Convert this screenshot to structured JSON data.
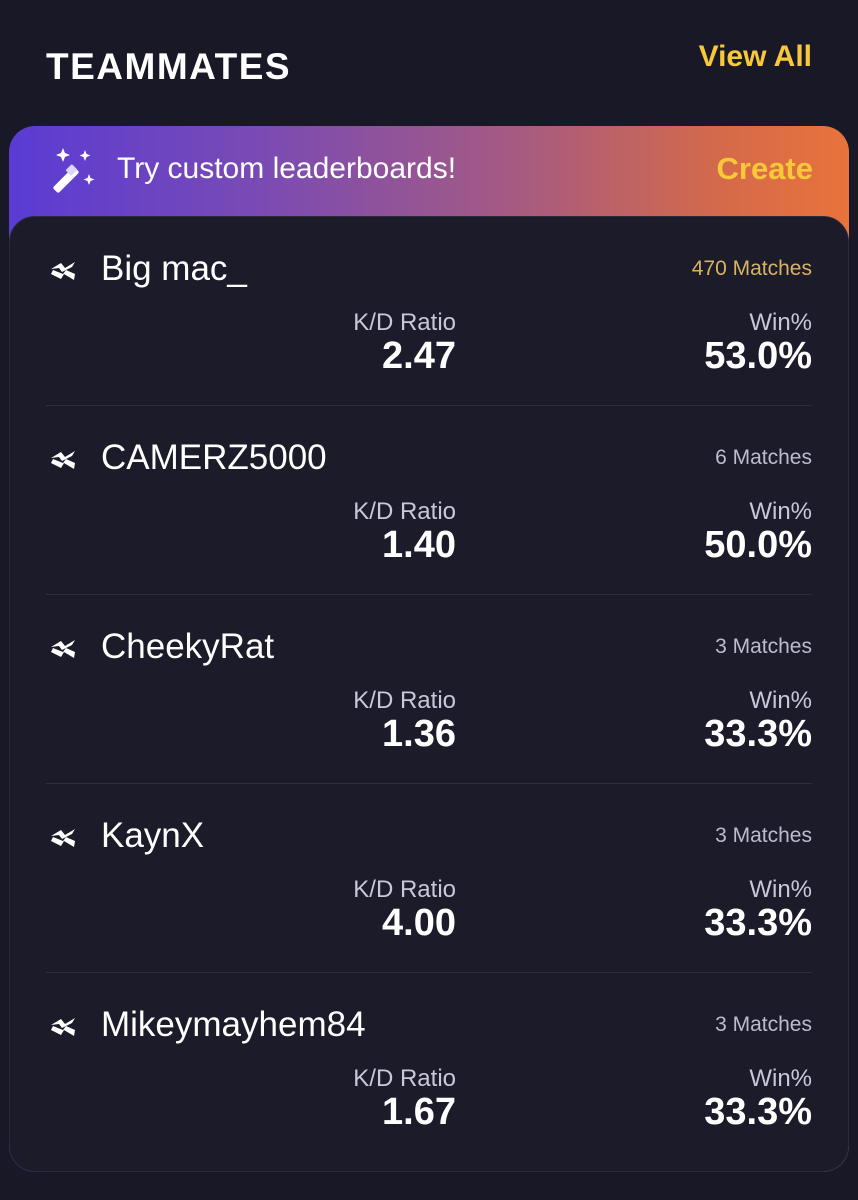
{
  "header": {
    "title": "TEAMMATES",
    "view_all_label": "View All"
  },
  "promo": {
    "text": "Try custom leaderboards!",
    "create_label": "Create",
    "icon": "magic-wand-icon"
  },
  "labels": {
    "kd": "K/D Ratio",
    "win": "Win%"
  },
  "teammates": [
    {
      "name": "Big mac_",
      "matches": "470 Matches",
      "kd": "2.47",
      "win": "53.0%",
      "platform_icon": "xbox-logo-icon"
    },
    {
      "name": "CAMERZ5000",
      "matches": "6 Matches",
      "kd": "1.40",
      "win": "50.0%",
      "platform_icon": "xbox-logo-icon"
    },
    {
      "name": "CheekyRat",
      "matches": "3 Matches",
      "kd": "1.36",
      "win": "33.3%",
      "platform_icon": "xbox-logo-icon"
    },
    {
      "name": "KaynX",
      "matches": "3 Matches",
      "kd": "4.00",
      "win": "33.3%",
      "platform_icon": "xbox-logo-icon"
    },
    {
      "name": "Mikeymayhem84",
      "matches": "3 Matches",
      "kd": "1.67",
      "win": "33.3%",
      "platform_icon": "xbox-logo-icon"
    }
  ],
  "colors": {
    "accent": "#f8c83b",
    "background": "#181826",
    "card": "#1b1b2a",
    "gradient_start": "#5a3bd4",
    "gradient_end": "#e8733b"
  }
}
